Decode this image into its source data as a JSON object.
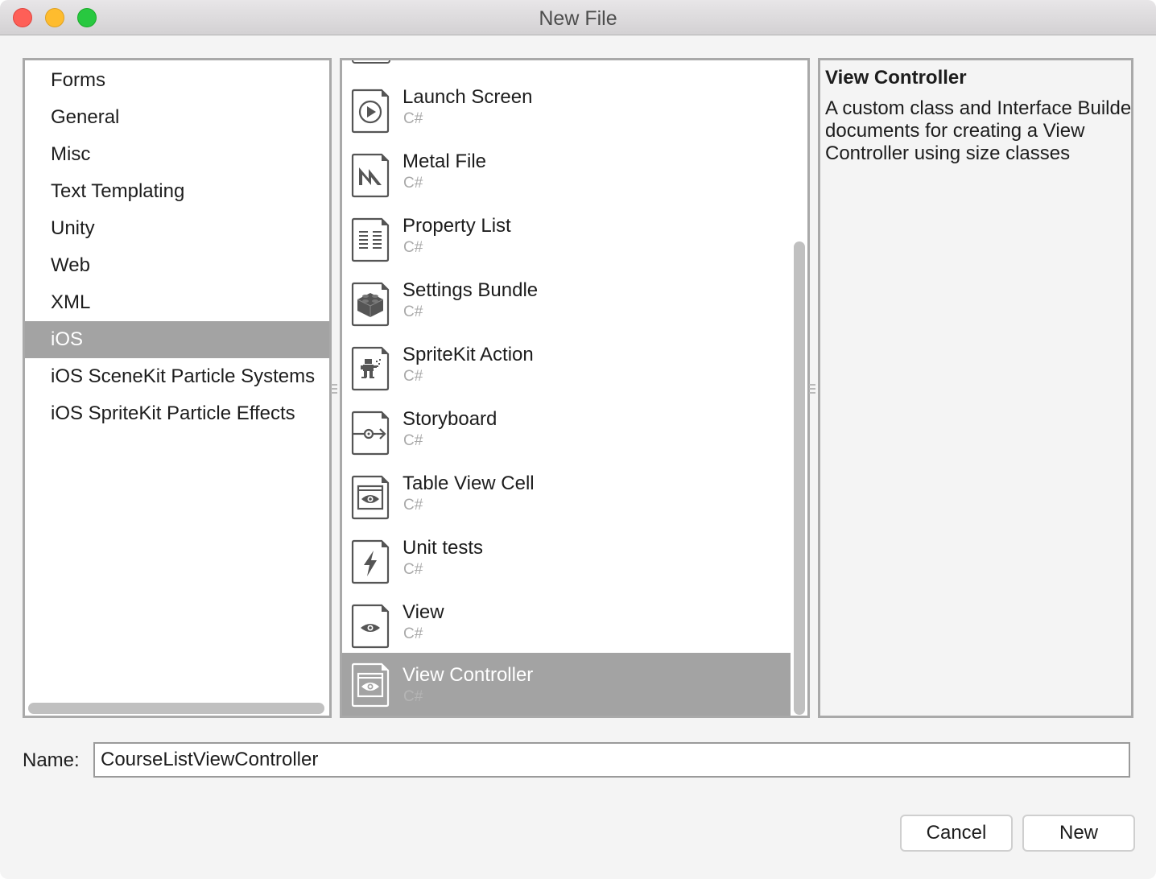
{
  "window": {
    "title": "New File",
    "controls": [
      "close",
      "minimize",
      "zoom"
    ]
  },
  "categories": {
    "items": [
      {
        "label": "Forms",
        "selected": false
      },
      {
        "label": "General",
        "selected": false
      },
      {
        "label": "Misc",
        "selected": false
      },
      {
        "label": "Text Templating",
        "selected": false
      },
      {
        "label": "Unity",
        "selected": false
      },
      {
        "label": "Web",
        "selected": false
      },
      {
        "label": "XML",
        "selected": false
      },
      {
        "label": "iOS",
        "selected": true
      },
      {
        "label": "iOS SceneKit Particle Systems",
        "selected": false
      },
      {
        "label": "iOS SpriteKit Particle Effects",
        "selected": false
      }
    ]
  },
  "templates": {
    "items": [
      {
        "name": "Launch Screen",
        "language": "C#",
        "icon": "play-icon",
        "selected": false
      },
      {
        "name": "Metal File",
        "language": "C#",
        "icon": "metal-icon",
        "selected": false
      },
      {
        "name": "Property List",
        "language": "C#",
        "icon": "property-list-icon",
        "selected": false
      },
      {
        "name": "Settings Bundle",
        "language": "C#",
        "icon": "lego-brick-icon",
        "selected": false
      },
      {
        "name": "SpriteKit Action",
        "language": "C#",
        "icon": "sprite-character-icon",
        "selected": false
      },
      {
        "name": "Storyboard",
        "language": "C#",
        "icon": "storyboard-segue-icon",
        "selected": false
      },
      {
        "name": "Table View Cell",
        "language": "C#",
        "icon": "window-eye-icon",
        "selected": false
      },
      {
        "name": "Unit tests",
        "language": "C#",
        "icon": "lightning-icon",
        "selected": false
      },
      {
        "name": "View",
        "language": "C#",
        "icon": "eye-icon",
        "selected": false
      },
      {
        "name": "View Controller",
        "language": "C#",
        "icon": "window-eye-icon",
        "selected": true
      }
    ]
  },
  "description": {
    "title": "View Controller",
    "body": "A custom class and Interface Builder documents for creating a View Controller using size classes"
  },
  "name_field": {
    "label": "Name:",
    "value": "CourseListViewController"
  },
  "buttons": {
    "cancel": "Cancel",
    "new": "New"
  },
  "colors": {
    "selection": "#a3a3a3",
    "panel_border": "#a9a9a9",
    "secondary_text": "#a9a9a9"
  }
}
